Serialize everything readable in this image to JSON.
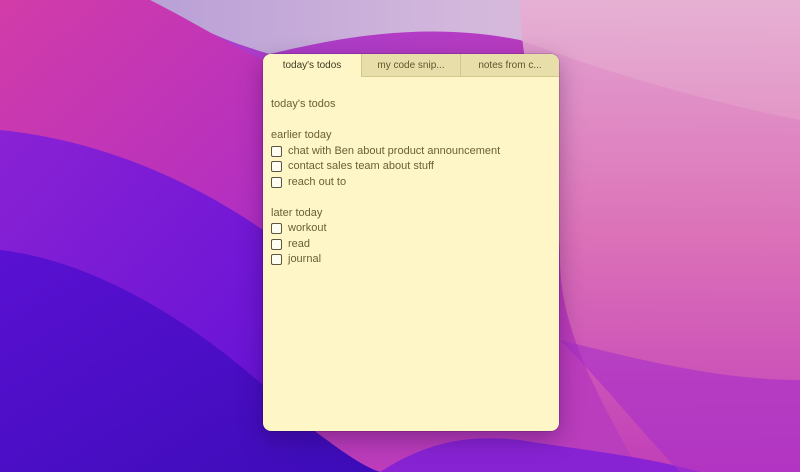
{
  "note": {
    "tabs": [
      {
        "label": "today's todos",
        "active": true
      },
      {
        "label": "my code snip...",
        "active": false
      },
      {
        "label": "notes from c...",
        "active": false
      }
    ],
    "title": "today's todos",
    "sections": [
      {
        "heading": "earlier today",
        "items": [
          {
            "label": "chat with Ben about product announcement",
            "checked": false
          },
          {
            "label": "contact sales team about stuff",
            "checked": false
          },
          {
            "label": "reach out to",
            "checked": false
          }
        ]
      },
      {
        "heading": "later today",
        "items": [
          {
            "label": "workout",
            "checked": false
          },
          {
            "label": "read",
            "checked": false
          },
          {
            "label": "journal",
            "checked": false
          }
        ]
      }
    ]
  },
  "colors": {
    "note_background": "#fef6c7",
    "tab_bar": "#e7deaa",
    "text": "#6a5f36"
  }
}
